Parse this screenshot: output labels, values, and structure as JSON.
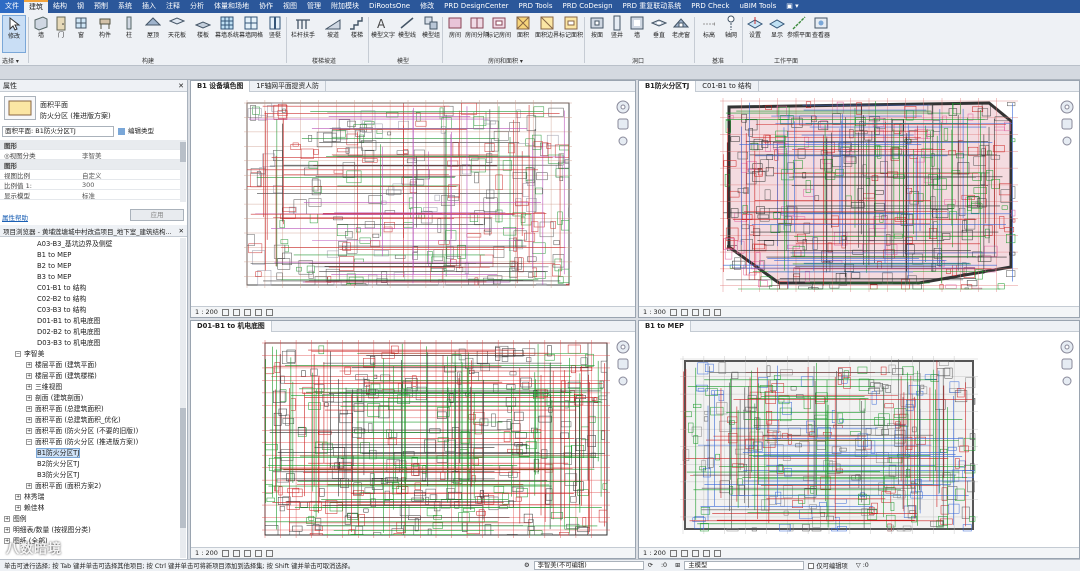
{
  "tabs": [
    "文件",
    "建筑",
    "结构",
    "钢",
    "预制",
    "系统",
    "插入",
    "注释",
    "分析",
    "体量和场地",
    "协作",
    "视图",
    "管理",
    "附加模块",
    "DiRootsOne",
    "修改",
    "PRD DesignCenter",
    "PRD Tools",
    "PRD CoDesign",
    "PRD 重复联动系统",
    "PRD Check",
    "uBIM Tools"
  ],
  "ribbon": {
    "modify": "修改",
    "select": "选择 ▾",
    "build": [
      "墙",
      "门",
      "窗",
      "构件",
      "柱",
      "屋顶",
      "天花板",
      "楼板",
      "幕墙系统",
      "幕墙网格",
      "竖梃"
    ],
    "build_group": "构建",
    "circ": [
      "栏杆扶手",
      "坡道",
      "楼梯"
    ],
    "circ_group": "楼梯坡道",
    "model": [
      "模型文字",
      "模型线",
      "模型组"
    ],
    "model_group": "模型",
    "room": [
      "房间",
      "房间分隔",
      "标记房间",
      "面积",
      "面积边界",
      "标记面积"
    ],
    "room_group": "房间和面积 ▾",
    "opening": [
      "按面",
      "竖井",
      "墙",
      "垂直",
      "老虎窗"
    ],
    "opening_group": "洞口",
    "datum": [
      "标高",
      "轴网"
    ],
    "datum_group": "基准",
    "work": [
      "设置",
      "显示",
      "参照平面",
      "查看器"
    ],
    "work_group": "工作平面"
  },
  "properties": {
    "header": "属性",
    "type_name": "面积平面",
    "type_sub": "防火分区 (推进版方案)",
    "selector": "面积平面: B1防火分区TJ",
    "edit_type": "编辑类型",
    "rows": [
      {
        "k": "图形",
        "v": "",
        "cat": true
      },
      {
        "k": "◎视图分类",
        "v": "李智美",
        "cat": false
      },
      {
        "k": "图形",
        "v": "",
        "cat": true
      },
      {
        "k": "视图比例",
        "v": "自定义",
        "cat": false
      },
      {
        "k": "比例值 1:",
        "v": "300",
        "cat": false
      },
      {
        "k": "显示模型",
        "v": "标准",
        "cat": false
      }
    ],
    "help": "属性帮助",
    "apply": "应用"
  },
  "browser": {
    "header": "项目浏览器 - 黄埔莲塘城中村改造项目_地下室_建筑结构...",
    "items": [
      {
        "t": "A03-B3_基坑边界及侧壁",
        "lv": 3
      },
      {
        "t": "B1 to MEP",
        "lv": 3
      },
      {
        "t": "B2 to MEP",
        "lv": 3
      },
      {
        "t": "B3 to MEP",
        "lv": 3
      },
      {
        "t": "C01-B1 to 结构",
        "lv": 3
      },
      {
        "t": "C02-B2 to 结构",
        "lv": 3
      },
      {
        "t": "C03-B3 to 结构",
        "lv": 3
      },
      {
        "t": "D01-B1 to 机电底图",
        "lv": 3
      },
      {
        "t": "D02-B2 to 机电底图",
        "lv": 3
      },
      {
        "t": "D03-B3 to 机电底图",
        "lv": 3
      },
      {
        "t": "李智美",
        "lv": 1,
        "pm": "−"
      },
      {
        "t": "楼层平面 (建筑平面)",
        "lv": 2,
        "pm": "+"
      },
      {
        "t": "楼层平面 (建筑楼梯)",
        "lv": 2,
        "pm": "+"
      },
      {
        "t": "三维视图",
        "lv": 2,
        "pm": "+"
      },
      {
        "t": "剖面 (建筑剖面)",
        "lv": 2,
        "pm": "+"
      },
      {
        "t": "面积平面 (总建筑面积)",
        "lv": 2,
        "pm": "+"
      },
      {
        "t": "面积平面 (总建筑面积_优化)",
        "lv": 2,
        "pm": "+"
      },
      {
        "t": "面积平面 (防火分区 (不要的旧版))",
        "lv": 2,
        "pm": "+"
      },
      {
        "t": "面积平面 (防火分区 (推进版方案))",
        "lv": 2,
        "pm": "−"
      },
      {
        "t": "B1防火分区TJ",
        "lv": 3,
        "sel": true
      },
      {
        "t": "B2防火分区TJ",
        "lv": 3
      },
      {
        "t": "B3防火分区TJ",
        "lv": 3
      },
      {
        "t": "面积平面 (面积方案2)",
        "lv": 2,
        "pm": "+"
      },
      {
        "t": "林秀瑞",
        "lv": 1,
        "pm": "+"
      },
      {
        "t": "赖佳林",
        "lv": 1,
        "pm": "+"
      },
      {
        "t": "图例",
        "lv": 0,
        "pm": "+"
      },
      {
        "t": "明细表/数量 (按视图分类)",
        "lv": 0,
        "pm": "+"
      },
      {
        "t": "图纸 (全部)",
        "lv": 0,
        "pm": "+"
      }
    ]
  },
  "views": {
    "tl": {
      "tabs": [
        "B1 设备填色图",
        "1F轴网平面提资人防"
      ],
      "scale": "1 : 200"
    },
    "tr": {
      "tabs": [
        "B1防火分区TJ",
        "C01-B1 to 结构"
      ],
      "scale": "1 : 300"
    },
    "bl": {
      "tabs": [
        "D01-B1 to 机电底图"
      ],
      "scale": "1 : 200"
    },
    "br": {
      "tabs": [
        "B1 to MEP"
      ],
      "scale": "1 : 200"
    }
  },
  "status": {
    "hint": "单击可进行选择; 按 Tab 键并单击可选择其他项目; 按 Ctrl 键并单击可将新项目添加到选择集; 按 Shift 键并单击可取消选择。",
    "workset": "李智美(不可编辑)",
    "zero": ":0",
    "model": "主模型",
    "editable": "仅可编辑项",
    "watermark": "八数暗境"
  },
  "colors": {
    "accent": "#2b579a",
    "orange": "#f2a33a",
    "select": "#cfe2f7"
  }
}
